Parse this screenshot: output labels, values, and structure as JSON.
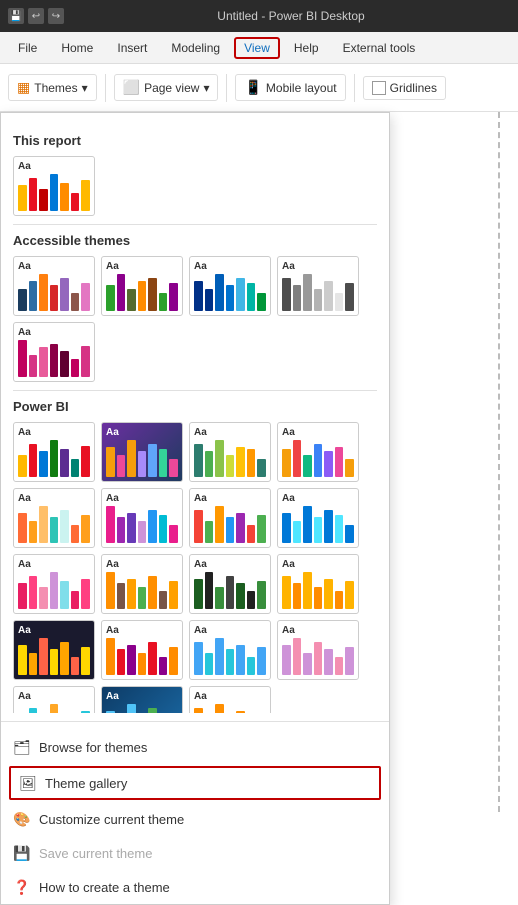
{
  "titleBar": {
    "title": "Untitled - Power BI Desktop",
    "icons": [
      "save",
      "undo",
      "redo"
    ]
  },
  "menuBar": {
    "items": [
      "File",
      "Home",
      "Insert",
      "Modeling",
      "View",
      "Help",
      "External tools"
    ],
    "activeItem": "View"
  },
  "toolbar": {
    "buttons": [
      {
        "label": "Themes",
        "hasDropdown": true,
        "hasIcon": true
      },
      {
        "label": "Page view",
        "hasDropdown": true,
        "hasIcon": true
      },
      {
        "label": "Mobile layout",
        "hasIcon": true
      },
      {
        "label": "Gridlines",
        "hasCheckbox": true
      }
    ]
  },
  "dropdown": {
    "sections": [
      {
        "title": "This report",
        "themes": [
          {
            "colors": [
              "#FFB900",
              "#E81123",
              "#0078D7",
              "#107C10",
              "#5C2D91",
              "#008272"
            ]
          }
        ]
      },
      {
        "title": "Accessible themes",
        "themes": [
          {
            "colors": [
              "#1A3C5E",
              "#2E6DA4",
              "#FF7F0E",
              "#D62728",
              "#9467BD",
              "#8C564B"
            ]
          },
          {
            "colors": [
              "#2CA02C",
              "#8B008B",
              "#FF1493",
              "#FF8C00",
              "#00CED1",
              "#4B0082"
            ]
          },
          {
            "colors": [
              "#003087",
              "#005EB8",
              "#0072CE",
              "#41B6E6",
              "#00B5A5",
              "#009639"
            ]
          },
          {
            "colors": [
              "#4D4D4D",
              "#7F7F7F",
              "#999999",
              "#B3B3B3",
              "#CCCCCC",
              "#E5E5E5"
            ]
          },
          {
            "colors": [
              "#C0005E",
              "#D63384",
              "#E85B9A",
              "#F589B8",
              "#8B0045",
              "#600030"
            ]
          }
        ]
      },
      {
        "title": "Power BI",
        "themes": [
          {
            "colors": [
              "#FFB900",
              "#E81123",
              "#0078D7",
              "#107C10",
              "#5C2D91",
              "#008272"
            ]
          },
          {
            "colors": [
              "#8B5CF6",
              "#A78BFA",
              "#EC4899",
              "#F59E0B",
              "#3B82F6",
              "#10B981"
            ],
            "dark": true
          },
          {
            "colors": [
              "#2D7D6F",
              "#4CAF50",
              "#8BC34A",
              "#CDDC39",
              "#FFC107",
              "#FF9800"
            ]
          },
          {
            "colors": [
              "#F59E0B",
              "#EF4444",
              "#10B981",
              "#3B82F6",
              "#8B5CF6",
              "#EC4899"
            ]
          },
          {
            "colors": [
              "#FF6B35",
              "#FF9F1C",
              "#FFBF69",
              "#CBF3F0",
              "#2EC4B6",
              "#CBF3F0"
            ]
          },
          {
            "colors": [
              "#E91E8C",
              "#9C27B0",
              "#673AB7",
              "#3F51B5",
              "#2196F3",
              "#00BCD4"
            ]
          },
          {
            "colors": [
              "#F44336",
              "#FF9800",
              "#FFEB3B",
              "#4CAF50",
              "#2196F3",
              "#9C27B0"
            ]
          },
          {
            "colors": [
              "#FF5722",
              "#795548",
              "#9E9E9E",
              "#607D8B",
              "#F44336",
              "#E91E63"
            ]
          },
          {
            "colors": [
              "#1B5E20",
              "#388E3C",
              "#66BB6A",
              "#A5D6A7",
              "#C8E6C9",
              "#E8F5E9"
            ]
          },
          {
            "colors": [
              "#F57F17",
              "#F9A825",
              "#FBC02D",
              "#F57C00",
              "#E65100",
              "#BF360C"
            ]
          },
          {
            "colors": [
              "#212121",
              "#424242",
              "#FF6F00",
              "#FFB300",
              "#FFCA28",
              "#FFD54F"
            ]
          },
          {
            "colors": [
              "#880E4F",
              "#AD1457",
              "#C2185B",
              "#D81B60",
              "#E91E63",
              "#EC407A"
            ]
          },
          {
            "colors": [
              "#0D47A1",
              "#1565C0",
              "#1976D2",
              "#1E88E5",
              "#2196F3",
              "#42A5F5"
            ]
          },
          {
            "colors": [
              "#7B1FA2",
              "#8E24AA",
              "#9C27B0",
              "#BA68C8",
              "#CE93D8",
              "#E1BEE7"
            ]
          },
          {
            "colors": [
              "#4E8A6A",
              "#7EC8A0",
              "#FFA07A",
              "#FF6347",
              "#FFD700",
              "#90EE90"
            ]
          },
          {
            "colors": [
              "#3E2723",
              "#4E342E",
              "#5D4037",
              "#795548",
              "#A1887F",
              "#BCAAA4"
            ]
          },
          {
            "colors": [
              "#006064",
              "#00838F",
              "#0097A7",
              "#00ACC1",
              "#00BCD4",
              "#26C6DA"
            ]
          },
          {
            "colors": [
              "#FF8F00",
              "#FFA000",
              "#FFB300",
              "#FFC107",
              "#FFCA28",
              "#FFD54F"
            ]
          },
          {
            "colors": [
              "#B71C1C",
              "#C62828",
              "#D32F2F",
              "#E53935",
              "#F44336",
              "#EF5350"
            ]
          },
          {
            "colors": [
              "#4A148C",
              "#6A1B9A",
              "#7B1FA2",
              "#8E24AA",
              "#9C27B0",
              "#AB47BC"
            ]
          }
        ]
      }
    ],
    "menuItems": [
      {
        "label": "Browse for themes",
        "icon": "browse",
        "disabled": false,
        "highlighted": false
      },
      {
        "label": "Theme gallery",
        "icon": "gallery",
        "disabled": false,
        "highlighted": true
      },
      {
        "label": "Customize current theme",
        "icon": "customize",
        "disabled": false,
        "highlighted": false
      },
      {
        "label": "Save current theme",
        "icon": "save",
        "disabled": true,
        "highlighted": false
      },
      {
        "label": "How to create a theme",
        "icon": "help",
        "disabled": false,
        "highlighted": false
      }
    ]
  }
}
